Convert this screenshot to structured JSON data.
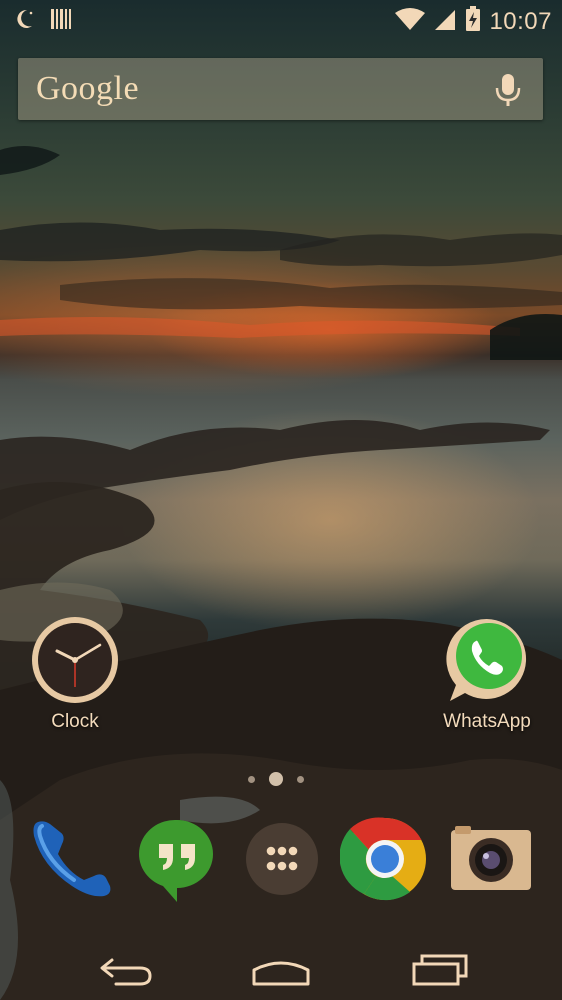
{
  "status_bar": {
    "time": "10:07",
    "left_icons": [
      "moon-icon",
      "barcode-icon"
    ],
    "right_icons": [
      "wifi-icon",
      "signal-icon",
      "battery-charging-icon"
    ]
  },
  "search": {
    "logo_text": "Google",
    "mic_icon": "mic-icon"
  },
  "desktop": {
    "apps": [
      {
        "label": "Clock",
        "icon": "clock-icon"
      },
      {
        "label": "WhatsApp",
        "icon": "whatsapp-icon"
      }
    ]
  },
  "pager": {
    "pages": 3,
    "current": 2
  },
  "dock": {
    "items": [
      {
        "name": "Phone",
        "icon": "phone-icon"
      },
      {
        "name": "Hangouts",
        "icon": "hangouts-icon"
      },
      {
        "name": "All apps",
        "icon": "app-drawer-icon"
      },
      {
        "name": "Chrome",
        "icon": "chrome-icon"
      },
      {
        "name": "Camera",
        "icon": "camera-icon"
      }
    ]
  },
  "navigation": {
    "buttons": [
      "back-icon",
      "home-icon",
      "recents-icon"
    ]
  },
  "colors": {
    "accent": "#f2d8b8",
    "whatsapp": "#3fb83f",
    "hangouts": "#3d9a2e"
  }
}
